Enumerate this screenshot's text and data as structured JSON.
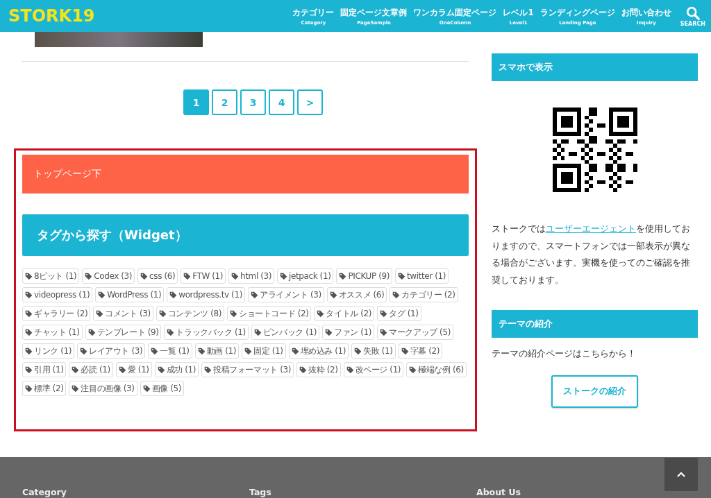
{
  "header": {
    "logo": "STORK19",
    "nav": [
      {
        "label": "カテゴリー",
        "sub": "Category"
      },
      {
        "label": "固定ページ文章例",
        "sub": "PageSample"
      },
      {
        "label": "ワンカラム固定ページ",
        "sub": "OneColumn"
      },
      {
        "label": "レベル1",
        "sub": "Level1"
      },
      {
        "label": "ランディングページ",
        "sub": "Landing Page"
      },
      {
        "label": "お問い合わせ",
        "sub": "Inquiry"
      }
    ],
    "search_label": "SEARCH"
  },
  "pagination": [
    {
      "label": "1",
      "selected": true
    },
    {
      "label": "2",
      "selected": false
    },
    {
      "label": "3",
      "selected": false
    },
    {
      "label": "4",
      "selected": false
    },
    {
      "label": ">",
      "selected": false
    }
  ],
  "widget_area": {
    "banner": "トップページ下",
    "title": "タグから探す（Widget）",
    "tags": [
      "8ビット (1)",
      "Codex (3)",
      "css (6)",
      "FTW (1)",
      "html (3)",
      "jetpack (1)",
      "PICKUP (9)",
      "twitter (1)",
      "videopress (1)",
      "WordPress (1)",
      "wordpress.tv (1)",
      "アライメント (3)",
      "オススメ (6)",
      "カテゴリー (2)",
      "ギャラリー (2)",
      "コメント (3)",
      "コンテンツ (8)",
      "ショートコード (2)",
      "タイトル (2)",
      "タグ (1)",
      "チャット (1)",
      "テンプレート (9)",
      "トラックバック (1)",
      "ピンバック (1)",
      "ファン (1)",
      "マークアップ (5)",
      "リンク (1)",
      "レイアウト (3)",
      "一覧 (1)",
      "動画 (1)",
      "固定 (1)",
      "埋め込み (1)",
      "失敗 (1)",
      "字幕 (2)",
      "引用 (1)",
      "必読 (1)",
      "愛 (1)",
      "成功 (1)",
      "投稿フォーマット (3)",
      "抜粋 (2)",
      "改ページ (1)",
      "極端な例 (6)",
      "標準 (2)",
      "注目の画像 (3)",
      "画像 (5)"
    ]
  },
  "sidebar": {
    "mobile_heading": "スマホで表示",
    "mobile_text_before": "ストークでは",
    "mobile_link": "ユーザーエージェント",
    "mobile_text_after": "を使用しておりますので、スマートフォンでは一部表示が異なる場合がございます。実機を使ってのご確認を推奨しております。",
    "theme_heading": "テーマの紹介",
    "theme_text": "テーマの紹介ページはこちらから！",
    "theme_button": "ストークの紹介"
  },
  "footer": {
    "columns": [
      "Category",
      "Tags",
      "About Us"
    ]
  }
}
